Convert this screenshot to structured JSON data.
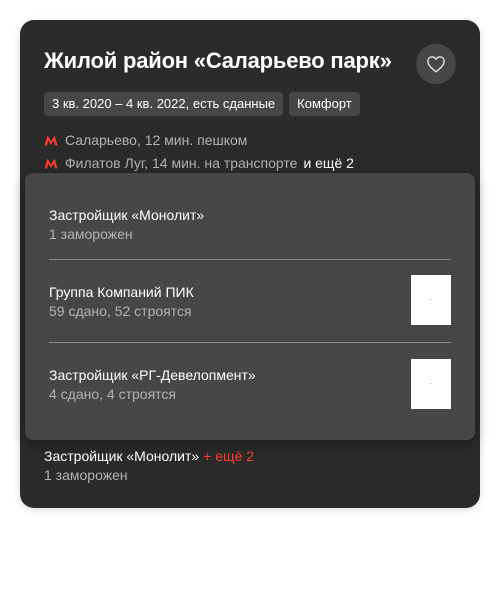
{
  "complex": {
    "title": "Жилой район «Саларьево парк»",
    "favorite_icon": "heart-icon",
    "tags": [
      "3 кв. 2020 – 4 кв. 2022, есть сданные",
      "Комфорт"
    ],
    "metro": [
      {
        "icon": "metro-icon",
        "text": "Саларьево, 12 мин. пешком"
      },
      {
        "icon": "metro-icon",
        "text": "Филатов Луг, 14 мин. на транспорте",
        "more": "и ещё 2"
      }
    ],
    "metro_color": "#ff3b30"
  },
  "popover": {
    "developers": [
      {
        "name": "Застройщик «Монолит»",
        "status": "1 заморожен",
        "has_logo": false
      },
      {
        "name": "Группа Компаний ПИК",
        "status": "59 сдано, 52 строятся",
        "has_logo": true
      },
      {
        "name": "Застройщик «РГ-Девелопмент»",
        "status": "4 сдано, 4 строятся",
        "has_logo": true
      }
    ]
  },
  "developer_summary": {
    "name": "Застройщик «Монолит»",
    "more": "+ ещё 2",
    "status": "1 заморожен",
    "more_color": "#ff3b30"
  }
}
